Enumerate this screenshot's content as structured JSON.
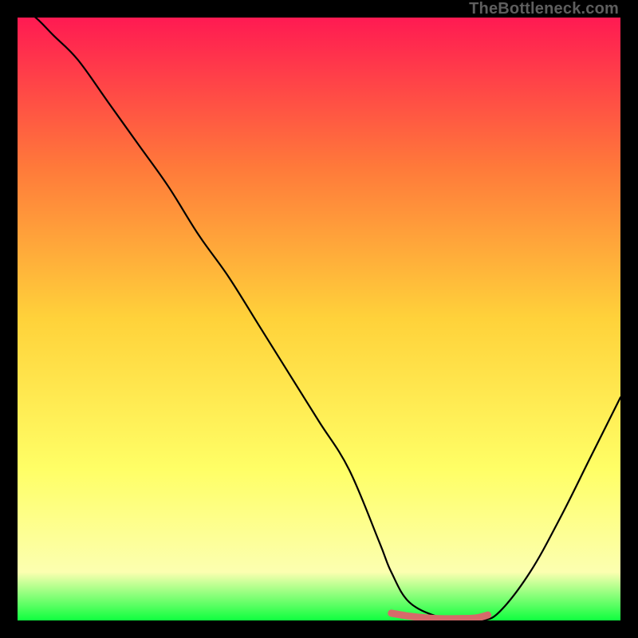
{
  "watermark": "TheBottleneck.com",
  "colors": {
    "gradient_top": "#ff1a52",
    "gradient_mid_upper": "#ff7a3a",
    "gradient_mid": "#ffd23a",
    "gradient_mid_lower": "#ffff66",
    "gradient_lower": "#fcffb0",
    "gradient_bottom": "#0fff3f",
    "curve": "#000000",
    "marker": "#d66a6a",
    "frame_bg": "#000000"
  },
  "chart_data": {
    "type": "line",
    "title": "",
    "xlabel": "",
    "ylabel": "",
    "xlim": [
      0,
      100
    ],
    "ylim": [
      0,
      100
    ],
    "series": [
      {
        "name": "bottleneck-curve",
        "x": [
          0,
          3,
          6,
          10,
          15,
          20,
          25,
          30,
          35,
          40,
          45,
          50,
          55,
          60,
          62,
          65,
          70,
          73,
          77,
          80,
          85,
          90,
          95,
          100
        ],
        "y": [
          102,
          100,
          97,
          93,
          86,
          79,
          72,
          64,
          57,
          49,
          41,
          33,
          25,
          13,
          8,
          3,
          0.5,
          0,
          0,
          1.5,
          8,
          17,
          27,
          37
        ]
      }
    ],
    "marker_segment": {
      "name": "optimal-range",
      "x": [
        62,
        65,
        68,
        70,
        73,
        76,
        78
      ],
      "y": [
        1.2,
        0.7,
        0.4,
        0.3,
        0.3,
        0.4,
        0.9
      ]
    }
  }
}
